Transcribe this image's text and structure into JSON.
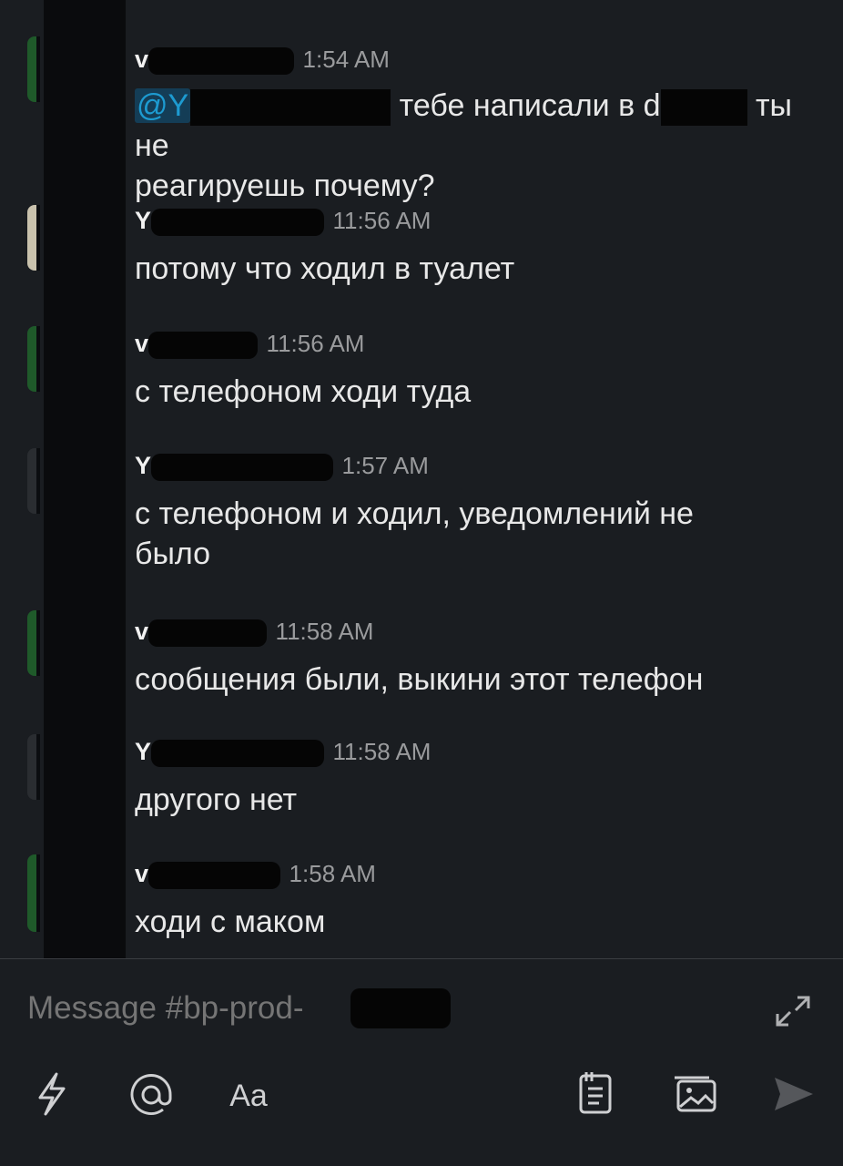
{
  "messages": [
    {
      "author": "v",
      "time": "1:54 AM",
      "mention": "@Y",
      "text_a": "тебе написали в d",
      "text_b": "ты не",
      "text_c": "реагируешь почему?"
    },
    {
      "author": "Y",
      "time": "11:56 AM",
      "text": "потому что ходил в туалет"
    },
    {
      "author": "v",
      "time": "11:56 AM",
      "text": "с телефоном ходи туда"
    },
    {
      "author": "Y",
      "time": "1:57 AM",
      "text_a": "с телефоном и ходил, уведомлений не",
      "text_b": "было"
    },
    {
      "author": "v",
      "time": "11:58 AM",
      "text": "сообщения были, выкини этот телефон"
    },
    {
      "author": "Y",
      "time": "11:58 AM",
      "text": "другого нет"
    },
    {
      "author": "v",
      "time": "1:58 AM",
      "text": "ходи с маком"
    }
  ],
  "composer": {
    "placeholder": "Message #bp-prod-",
    "format_label": "Aa"
  },
  "icons": [
    "shortcuts-icon",
    "mention-icon",
    "format-icon",
    "clipboard-icon",
    "image-icon",
    "send-icon",
    "expand-icon"
  ],
  "colors": {
    "background": "#1a1d21",
    "mention": "#1d9bd1",
    "timestamp": "#9a9b9d"
  }
}
